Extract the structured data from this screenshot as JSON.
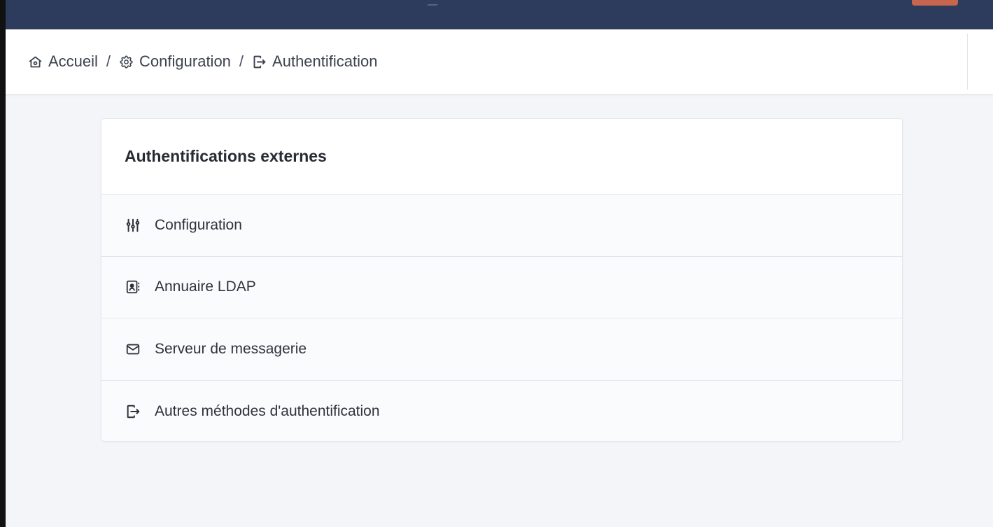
{
  "breadcrumb": {
    "items": [
      {
        "label": "Accueil",
        "icon": "home-icon"
      },
      {
        "label": "Configuration",
        "icon": "gear-icon"
      },
      {
        "label": "Authentification",
        "icon": "login-icon"
      }
    ],
    "separator": "/"
  },
  "card": {
    "title": "Authentifications externes",
    "items": [
      {
        "label": "Configuration",
        "icon": "adjustments-icon"
      },
      {
        "label": "Annuaire LDAP",
        "icon": "address-book-icon"
      },
      {
        "label": "Serveur de messagerie",
        "icon": "mail-icon"
      },
      {
        "label": "Autres méthodes d'authentification",
        "icon": "login-icon"
      }
    ]
  },
  "colors": {
    "topbar": "#2d3b5c",
    "page_background": "#f4f5f8",
    "badge": "#c8654e"
  }
}
